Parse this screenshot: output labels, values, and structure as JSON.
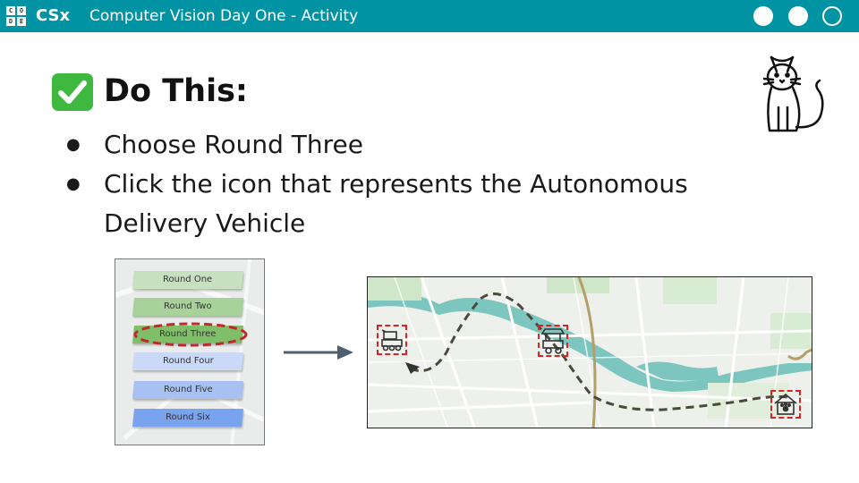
{
  "header": {
    "logo_letters": [
      "C",
      "O",
      "D",
      "E"
    ],
    "brand": "CSx",
    "title": "Computer Vision Day One - Activity",
    "color": "#0093a4"
  },
  "heading": {
    "text": "Do This:",
    "icon": "check-mark-icon"
  },
  "bullets": [
    "Choose Round Three",
    "Click the icon that represents the Autonomous Delivery Vehicle"
  ],
  "rounds": [
    {
      "label": "Round One",
      "color": "#c6e0c0"
    },
    {
      "label": "Round Two",
      "color": "#a7d29a"
    },
    {
      "label": "Round Three",
      "color": "#7fbf6a",
      "highlighted": true
    },
    {
      "label": "Round Four",
      "color": "#c9d9f7"
    },
    {
      "label": "Round Five",
      "color": "#a8c1f3"
    },
    {
      "label": "Round Six",
      "color": "#7aa3ef"
    }
  ],
  "map_icons": [
    "delivery-robot-icon",
    "food-cart-icon",
    "pet-house-icon"
  ],
  "decor_icon": "cat-icon"
}
